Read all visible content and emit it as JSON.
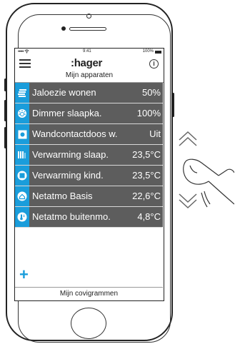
{
  "status_bar": {
    "signal": "•••••",
    "time": "9:41",
    "battery": "100%"
  },
  "header": {
    "logo": ":hager",
    "menu_icon": "hamburger-icon",
    "info_icon": "info-icon",
    "info_glyph": "i"
  },
  "section_title": "Mijn apparaten",
  "devices": [
    {
      "name": "Jaloezie wonen",
      "value": "50%",
      "icon": "blinds-icon"
    },
    {
      "name": "Dimmer slaapka.",
      "value": "100%",
      "icon": "dimmer-icon"
    },
    {
      "name": "Wandcontactdoos w.",
      "value": "Uit",
      "icon": "socket-icon"
    },
    {
      "name": "Verwarming slaap.",
      "value": "23,5°C",
      "icon": "heating-icon"
    },
    {
      "name": "Verwarming kind.",
      "value": "23,5°C",
      "icon": "heating-box-icon"
    },
    {
      "name": "Netatmo Basis",
      "value": "22,6°C",
      "icon": "house-icon"
    },
    {
      "name": "Netatmo buitenmo.",
      "value": "4,8°C",
      "icon": "thermometer-icon"
    }
  ],
  "add_label": "+",
  "footer_title": "Mijn covigrammen",
  "colors": {
    "accent": "#1a9ddb",
    "row_bg": "#5d5d5d"
  }
}
